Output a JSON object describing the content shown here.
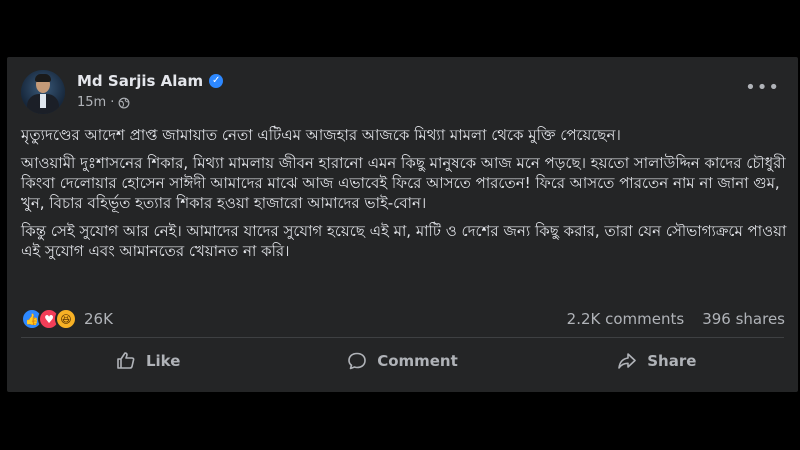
{
  "post": {
    "author": "Md Sarjis Alam",
    "verified": true,
    "time": "15m",
    "privacy_icon": "globe-icon",
    "more_icon": "more-options-icon",
    "paragraphs": [
      "মৃত্যুদণ্ডের আদেশ প্রাপ্ত জামায়াত নেতা এটিএম আজহার আজকে মিথ্যা মামলা থেকে মুক্তি পেয়েছেন।",
      "আওয়ামী দুঃশাসনের শিকার, মিথ্যা মামলায় জীবন হারানো এমন কিছু মানুষকে আজ মনে পড়ছে। হয়তো সালাউদ্দিন কাদের চৌধুরী কিংবা দেলোয়ার হোসেন সাঈদী আমাদের মাঝে আজ এভাবেই ফিরে আসতে পারতেন! ফিরে আসতে পারতেন নাম না জানা গুম, খুন, বিচার বহির্ভূত হত্যার শিকার হওয়া হাজারো আমাদের ভাই-বোন।",
      "কিন্তু সেই সুযোগ আর নেই। আমাদের যাদের সুযোগ হয়েছে এই মা, মাটি ও দেশের জন্য কিছু করার, তারা যেন সৌভাগ্যক্রমে পাওয়া এই সুযোগ এবং আমানতের খেয়ানত না করি।"
    ],
    "reactions": {
      "icons": [
        "like-reaction-icon",
        "love-reaction-icon",
        "haha-reaction-icon"
      ],
      "count": "26K",
      "colors": {
        "like": "#2d88ff",
        "love": "#f33e58",
        "haha": "#f7b125"
      }
    },
    "comments": "2.2K comments",
    "shares": "396 shares",
    "actions": {
      "like": "Like",
      "comment": "Comment",
      "share": "Share"
    }
  }
}
